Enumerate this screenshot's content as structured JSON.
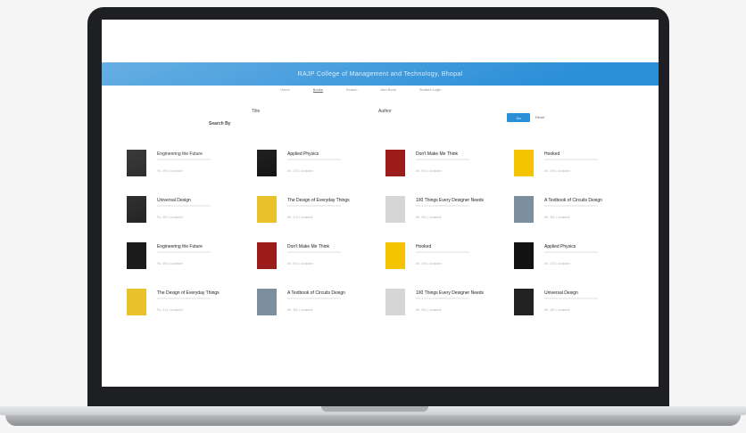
{
  "banner": {
    "title": "RAJP College of Management and Technology, Bhopal"
  },
  "nav": {
    "items": [
      "Home",
      "Books",
      "Search",
      "Add Book",
      "Student Login"
    ],
    "active_index": 1
  },
  "search": {
    "by_label": "Search By",
    "title_label": "Title",
    "author_label": "Author",
    "go_label": "Go",
    "reset_label": "Reset"
  },
  "books": [
    {
      "title": "Engineering the Future",
      "meta": "Rs. 450 | Available",
      "cover": "#1b1b1b"
    },
    {
      "title": "Applied Physics",
      "meta": "Rs. 320 | Available",
      "cover": "#121212"
    },
    {
      "title": "Don't Make Me Think",
      "meta": "Rs. 500 | Available",
      "cover": "#9c1b1b"
    },
    {
      "title": "Hooked",
      "meta": "Rs. 399 | Available",
      "cover": "#f4c400"
    },
    {
      "title": "Universal Design",
      "meta": "Rs. 280 | Available",
      "cover": "#222222"
    },
    {
      "title": "The Design of Everyday Things",
      "meta": "Rs. 410 | Available",
      "cover": "#e9c12b"
    },
    {
      "title": "100 Things Every Designer Needs",
      "meta": "Rs. 550 | Available",
      "cover": "#d6d6d6"
    },
    {
      "title": "A Textbook of Circuits Design",
      "meta": "Rs. 360 | Available",
      "cover": "#7b8f9f"
    },
    {
      "title": "Engineering the Future",
      "meta": "Rs. 450 | Available",
      "cover": "#1b1b1b"
    },
    {
      "title": "Don't Make Me Think",
      "meta": "Rs. 500 | Available",
      "cover": "#9c1b1b"
    },
    {
      "title": "Hooked",
      "meta": "Rs. 399 | Available",
      "cover": "#f4c400"
    },
    {
      "title": "Applied Physics",
      "meta": "Rs. 320 | Available",
      "cover": "#121212"
    },
    {
      "title": "The Design of Everyday Things",
      "meta": "Rs. 410 | Available",
      "cover": "#e9c12b"
    },
    {
      "title": "A Textbook of Circuits Design",
      "meta": "Rs. 360 | Available",
      "cover": "#7b8f9f"
    },
    {
      "title": "100 Things Every Designer Needs",
      "meta": "Rs. 550 | Available",
      "cover": "#d6d6d6"
    },
    {
      "title": "Universal Design",
      "meta": "Rs. 280 | Available",
      "cover": "#222222"
    }
  ],
  "colors": {
    "accent": "#2b8fd8",
    "bezel": "#1d1f22",
    "screen_bg": "#ffffff"
  }
}
